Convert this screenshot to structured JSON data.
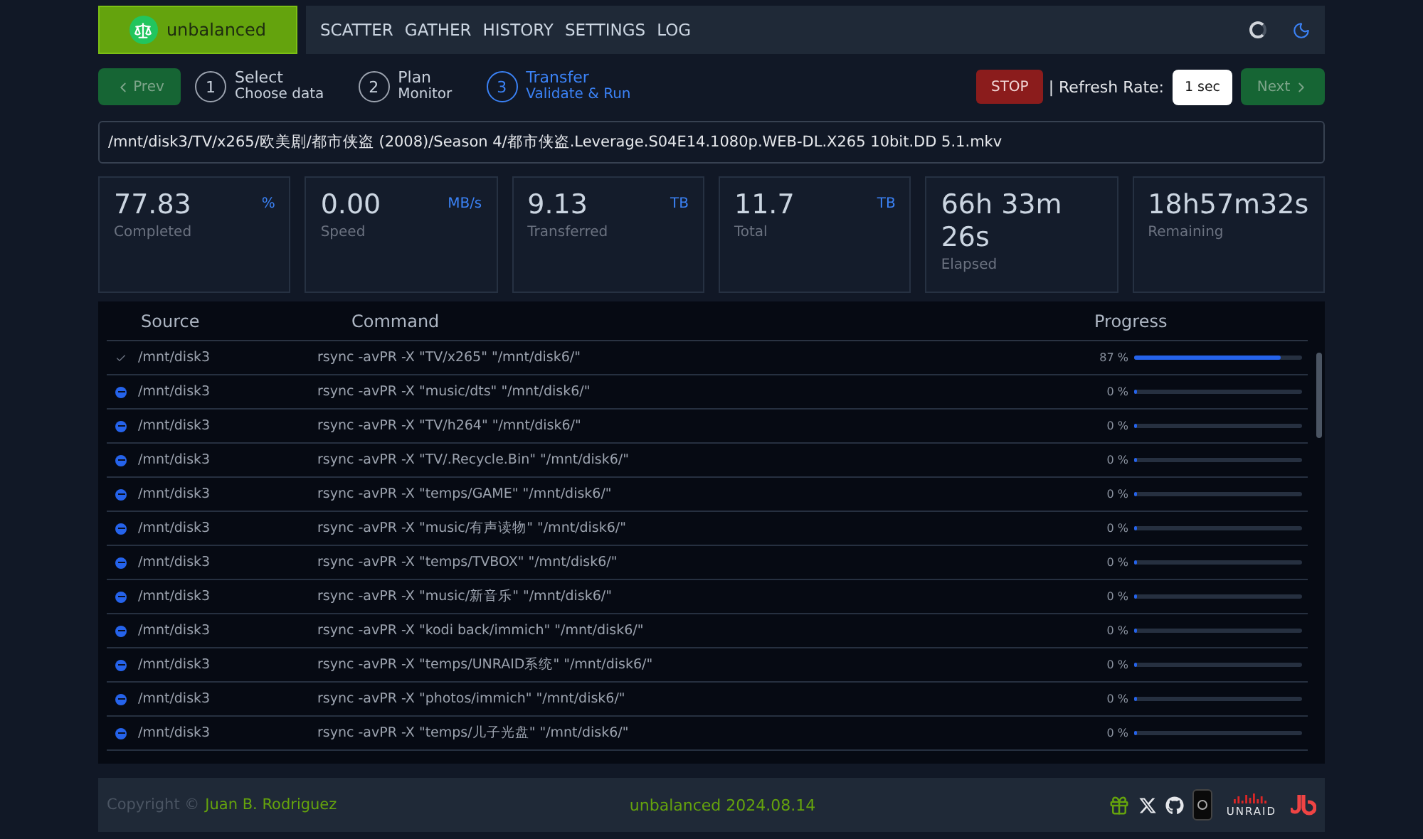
{
  "brand": {
    "name": "unbalanced"
  },
  "nav": [
    {
      "label": "SCATTER",
      "selected": false
    },
    {
      "label": "GATHER",
      "selected": false
    },
    {
      "label": "HISTORY",
      "selected": false
    },
    {
      "label": "SETTINGS",
      "selected": false
    },
    {
      "label": "LOG",
      "selected": false
    }
  ],
  "prev_button": "Prev",
  "steps": [
    {
      "number": "1",
      "title": "Select",
      "subtitle": "Choose data",
      "selected": false
    },
    {
      "number": "2",
      "title": "Plan",
      "subtitle": "Monitor",
      "selected": false
    },
    {
      "number": "3",
      "title": "Transfer",
      "subtitle": "Validate & Run",
      "selected": true
    }
  ],
  "stop_button": "STOP",
  "refresh_label": "| Refresh Rate:",
  "refresh_rate": "1 sec",
  "next_button": "Next",
  "current_file": "/mnt/disk3/TV/x265/欧美剧/都市侠盗 (2008)/Season 4/都市侠盗.Leverage.S04E14.1080p.WEB-DL.X265 10bit.DD 5.1.mkv",
  "stats": [
    {
      "value": "77.83",
      "unit": "%",
      "label": "Completed"
    },
    {
      "value": "0.00",
      "unit": "MB/s",
      "label": "Speed"
    },
    {
      "value": "9.13",
      "unit": "TB",
      "label": "Transferred"
    },
    {
      "value": "11.7",
      "unit": "TB",
      "label": "Total"
    },
    {
      "value": "66h 33m 26s",
      "label": "Elapsed"
    },
    {
      "value": "18h57m32s",
      "label": "Remaining"
    }
  ],
  "table": {
    "columns": [
      "Source",
      "Command",
      "Progress"
    ],
    "rows": [
      {
        "kind": "running",
        "source": "/mnt/disk3",
        "command": "rsync -avPR -X \"TV/x265\" \"/mnt/disk6/\"",
        "reading": "87 %",
        "level": 0.87
      },
      {
        "kind": "pending",
        "source": "/mnt/disk3",
        "command": "rsync -avPR -X \"music/dts\" \"/mnt/disk6/\"",
        "reading": "0 %",
        "level": 0
      },
      {
        "kind": "pending",
        "source": "/mnt/disk3",
        "command": "rsync -avPR -X \"TV/h264\" \"/mnt/disk6/\"",
        "reading": "0 %",
        "level": 0
      },
      {
        "kind": "pending",
        "source": "/mnt/disk3",
        "command": "rsync -avPR -X \"TV/.Recycle.Bin\" \"/mnt/disk6/\"",
        "reading": "0 %",
        "level": 0
      },
      {
        "kind": "pending",
        "source": "/mnt/disk3",
        "command": "rsync -avPR -X \"temps/GAME\" \"/mnt/disk6/\"",
        "reading": "0 %",
        "level": 0
      },
      {
        "kind": "pending",
        "source": "/mnt/disk3",
        "command": "rsync -avPR -X \"music/有声读物\" \"/mnt/disk6/\"",
        "reading": "0 %",
        "level": 0
      },
      {
        "kind": "pending",
        "source": "/mnt/disk3",
        "command": "rsync -avPR -X \"temps/TVBOX\" \"/mnt/disk6/\"",
        "reading": "0 %",
        "level": 0
      },
      {
        "kind": "pending",
        "source": "/mnt/disk3",
        "command": "rsync -avPR -X \"music/新音乐\" \"/mnt/disk6/\"",
        "reading": "0 %",
        "level": 0
      },
      {
        "kind": "pending",
        "source": "/mnt/disk3",
        "command": "rsync -avPR -X \"kodi back/immich\" \"/mnt/disk6/\"",
        "reading": "0 %",
        "level": 0
      },
      {
        "kind": "pending",
        "source": "/mnt/disk3",
        "command": "rsync -avPR -X \"temps/UNRAID系统\" \"/mnt/disk6/\"",
        "reading": "0 %",
        "level": 0
      },
      {
        "kind": "pending",
        "source": "/mnt/disk3",
        "command": "rsync -avPR -X \"photos/immich\" \"/mnt/disk6/\"",
        "reading": "0 %",
        "level": 0
      },
      {
        "kind": "pending",
        "source": "/mnt/disk3",
        "command": "rsync -avPR -X \"temps/儿子光盘\" \"/mnt/disk6/\"",
        "reading": "0 %",
        "level": 0
      }
    ]
  },
  "footer": {
    "copyright": "Copyright ©",
    "author": "Juan B. Rodriguez",
    "version": "unbalanced 2024.08.14",
    "unraid": "UNRAID"
  }
}
